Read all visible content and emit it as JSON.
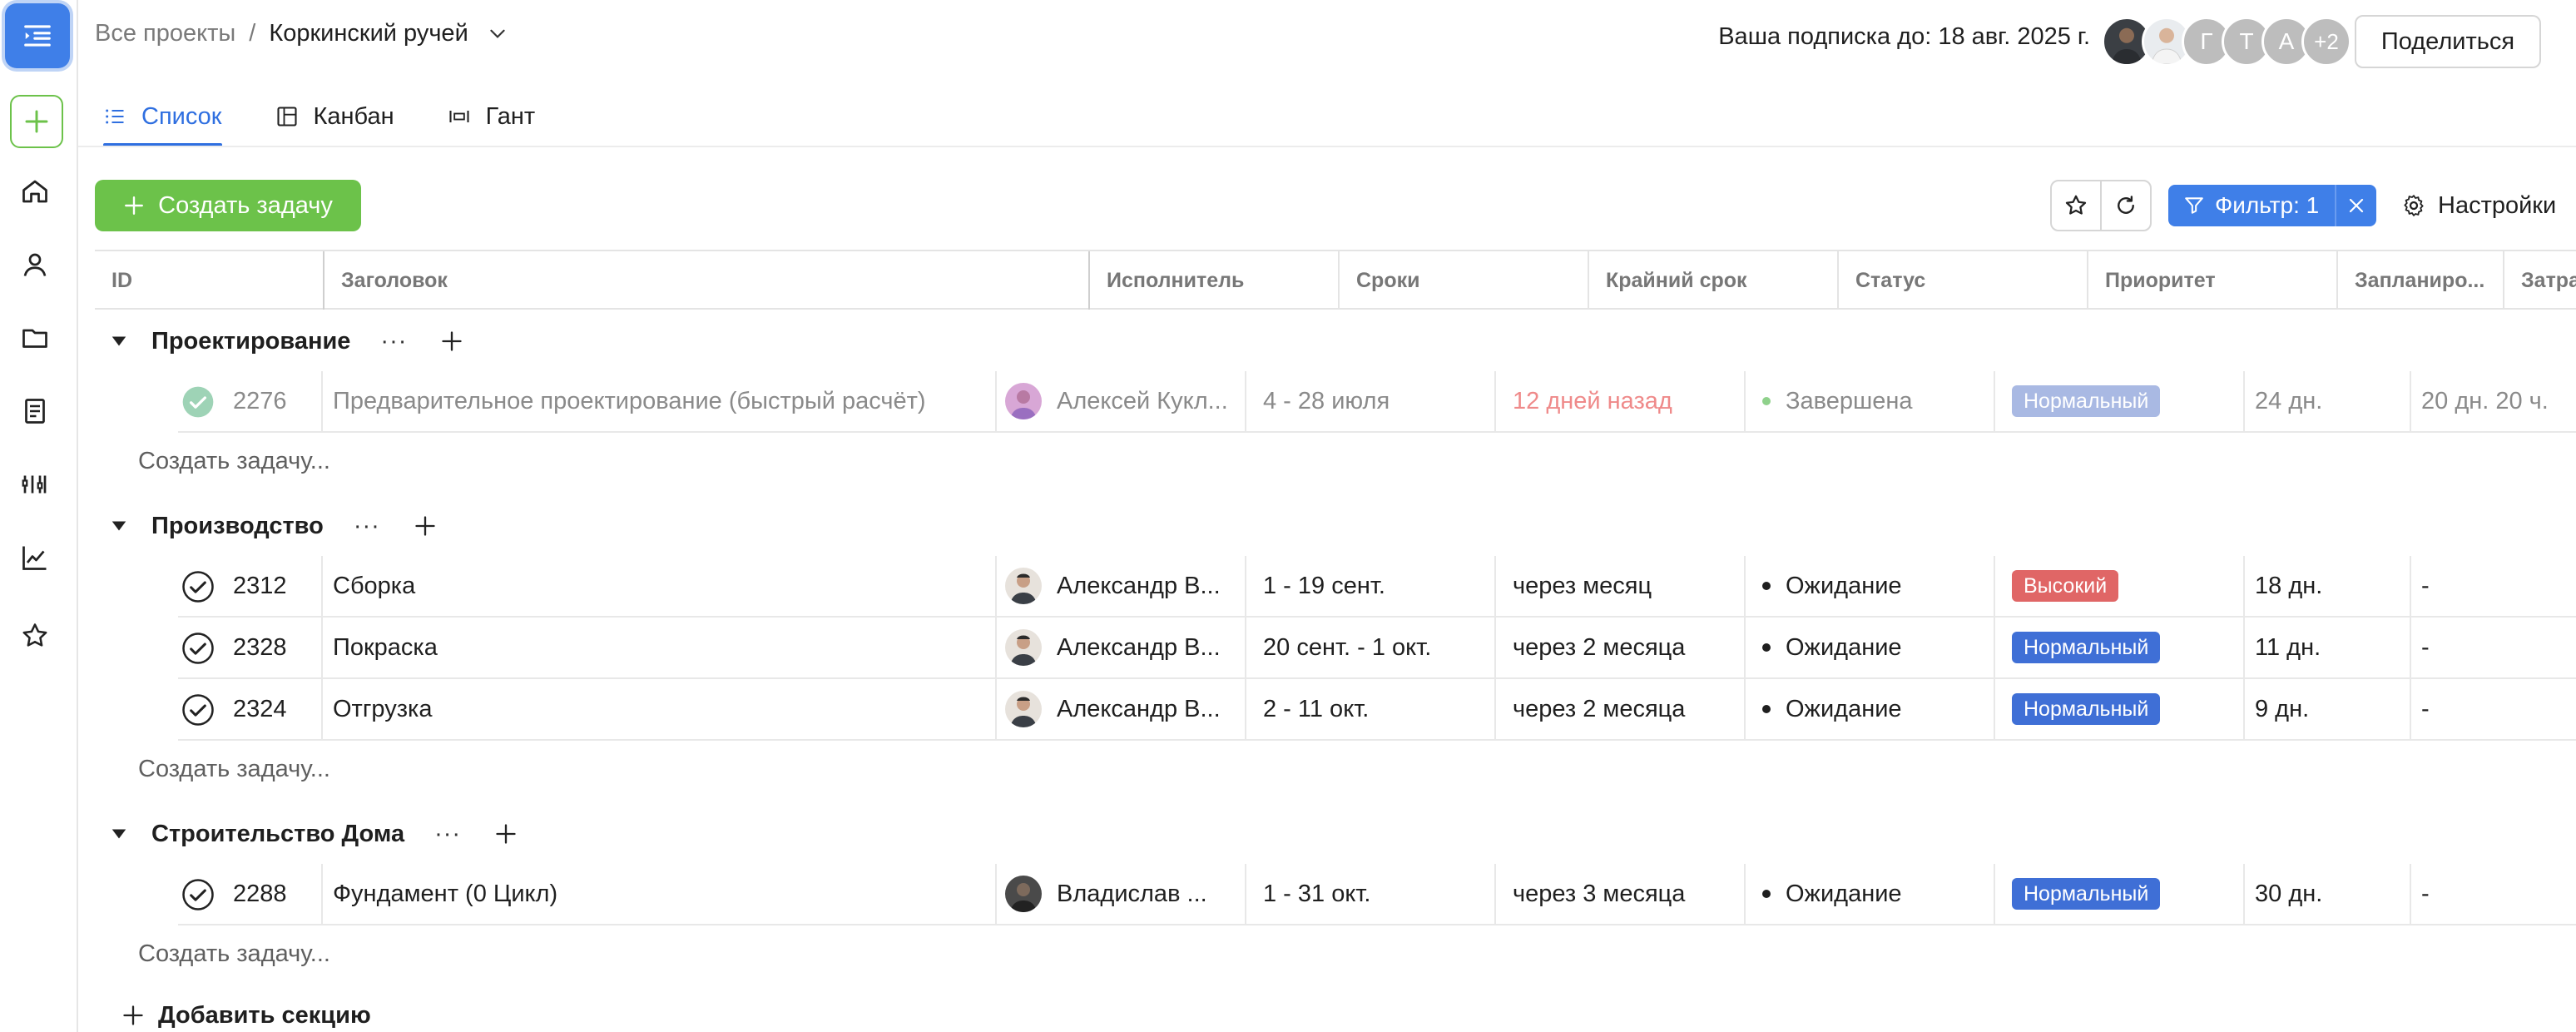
{
  "breadcrumb": {
    "root": "Все проекты",
    "separator": "/",
    "project": "Коркинский ручей"
  },
  "subscription": "Ваша подписка до: 18 авг. 2025 г.",
  "avatars": {
    "letters": [
      "Г",
      "Т",
      "А"
    ],
    "overflow": "+2",
    "colors": [
      "#bdbdbd",
      "#bdbdbd",
      "#bdbdbd",
      "#bdbdbd"
    ]
  },
  "share_label": "Поделиться",
  "tabs": [
    {
      "label": "Список",
      "icon": "list-icon",
      "active": true
    },
    {
      "label": "Канбан",
      "icon": "kanban-icon"
    },
    {
      "label": "Гант",
      "icon": "gantt-icon"
    }
  ],
  "toolbar": {
    "create_label": "Создать задачу",
    "filter_label": "Фильтр: 1",
    "settings_label": "Настройки"
  },
  "columns": [
    "ID",
    "Заголовок",
    "Исполнитель",
    "Сроки",
    "Крайний срок",
    "Статус",
    "Приоритет",
    "Запланиро...",
    "Затрачено ..."
  ],
  "create_task_label": "Создать задачу...",
  "add_section_label": "Добавить секцию",
  "colors": {
    "accent": "#2f6fe0",
    "green": "#6cc24a",
    "overdue": "#ef8a8a",
    "priority_high": "#e06666",
    "priority_normal": "#3f6fd6",
    "priority_normal_done": "#a9b9e3"
  },
  "sections": [
    {
      "name": "Проектирование",
      "dots": "···",
      "tasks": [
        {
          "id": "2276",
          "title": "Предварительное проектирование (быстрый расчёт)",
          "assignee": "Алексей Кукл...",
          "dates": "4 - 28 июля",
          "deadline": "12 дней назад",
          "status": "Завершена",
          "priority": "Нормальный",
          "planned": "24 дн.",
          "spent": "20 дн. 20 ч.",
          "done": true
        }
      ]
    },
    {
      "name": "Производство",
      "dots": "···",
      "tasks": [
        {
          "id": "2312",
          "title": "Сборка",
          "assignee": "Александр В...",
          "dates": "1 - 19 сент.",
          "deadline": "через месяц",
          "status": "Ожидание",
          "priority": "Высокий",
          "planned": "18 дн.",
          "spent": "-"
        },
        {
          "id": "2328",
          "title": "Покраска",
          "assignee": "Александр В...",
          "dates": "20 сент. - 1 окт.",
          "deadline": "через 2 месяца",
          "status": "Ожидание",
          "priority": "Нормальный",
          "planned": "11 дн.",
          "spent": "-"
        },
        {
          "id": "2324",
          "title": "Отгрузка",
          "assignee": "Александр В...",
          "dates": "2 - 11 окт.",
          "deadline": "через 2 месяца",
          "status": "Ожидание",
          "priority": "Нормальный",
          "planned": "9 дн.",
          "spent": "-"
        }
      ]
    },
    {
      "name": "Строительство Дома",
      "dots": "···",
      "tasks": [
        {
          "id": "2288",
          "title": "Фундамент (0 Цикл)",
          "assignee": "Владислав ...",
          "dates": "1 - 31 окт.",
          "deadline": "через 3 месяца",
          "status": "Ожидание",
          "priority": "Нормальный",
          "planned": "30 дн.",
          "spent": "-"
        }
      ]
    }
  ]
}
